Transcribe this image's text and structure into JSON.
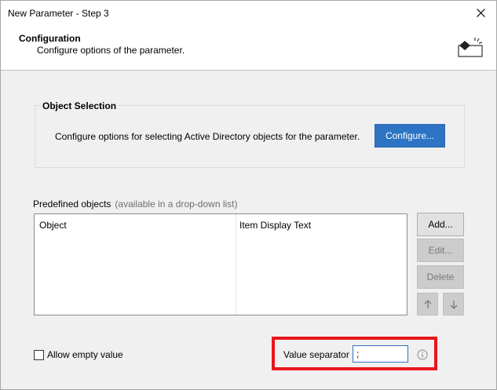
{
  "window": {
    "title": "New Parameter - Step 3"
  },
  "header": {
    "title": "Configuration",
    "subtitle": "Configure options of the parameter."
  },
  "object_selection": {
    "title": "Object Selection",
    "description": "Configure options for selecting Active Directory objects for the parameter.",
    "configure_label": "Configure..."
  },
  "predefined": {
    "label": "Predefined objects",
    "note": "(available in a drop-down list)",
    "columns": [
      "Object",
      "Item Display Text"
    ],
    "rows": []
  },
  "buttons": {
    "add": "Add...",
    "edit": "Edit...",
    "delete": "Delete",
    "up_icon": "arrow-up-icon",
    "down_icon": "arrow-down-icon"
  },
  "allow_empty": {
    "label": "Allow empty value",
    "checked": false
  },
  "value_separator": {
    "label": "Value separator",
    "value": ";"
  },
  "colors": {
    "accent": "#2d74c4",
    "highlight": "#e8161d",
    "disabled_bg": "#cccccc"
  }
}
